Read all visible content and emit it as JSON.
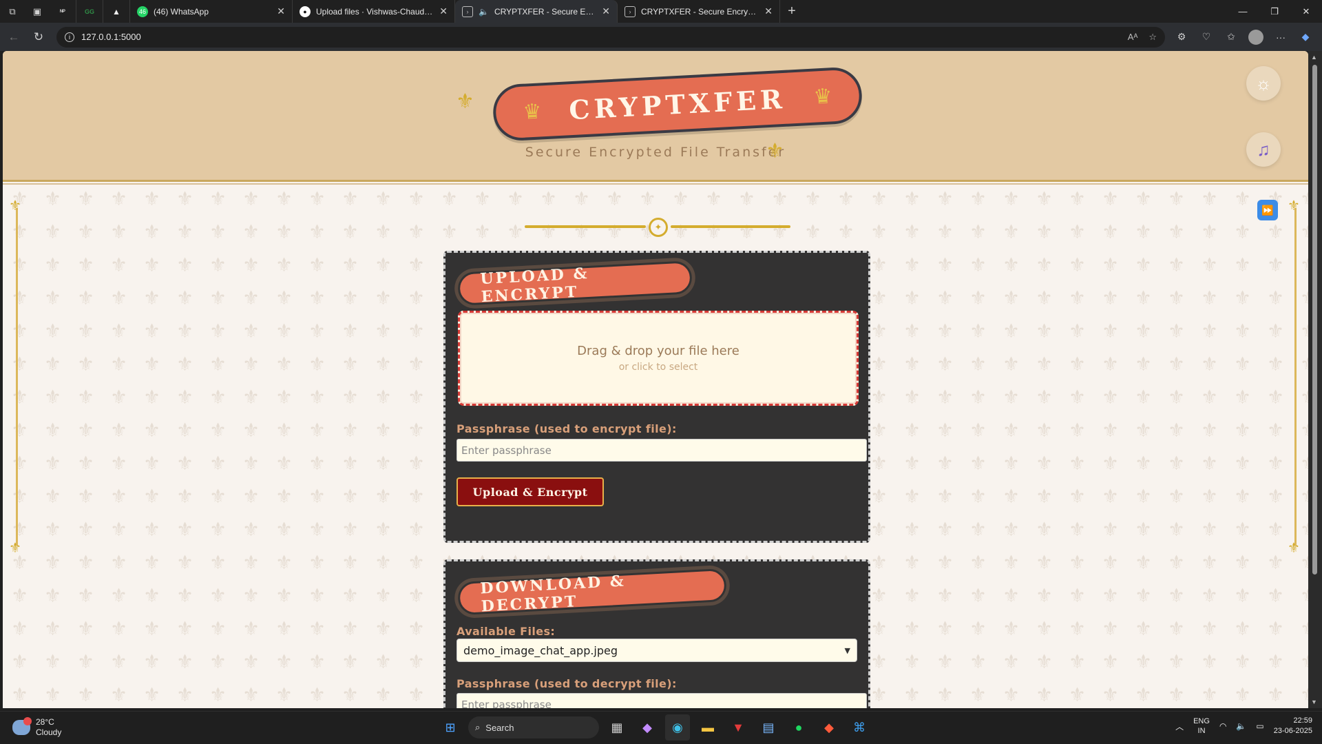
{
  "browser": {
    "tabs": [
      {
        "title": "(46) WhatsApp",
        "favicon": "whatsapp-icon",
        "active": false
      },
      {
        "title": "Upload files · Vishwas-Chaudhary",
        "favicon": "github-icon",
        "active": false
      },
      {
        "title": "CRYPTXFER - Secure Encrypte",
        "favicon": "page-icon",
        "active": true,
        "audio": true
      },
      {
        "title": "CRYPTXFER - Secure Encrypted Fi",
        "favicon": "page-icon",
        "active": false
      }
    ],
    "pinned": [
      "nptel-icon",
      "gfg-icon",
      "drive-icon"
    ],
    "whatsapp_badge": "46",
    "url": "127.0.0.1:5000"
  },
  "page": {
    "logo": "CRYPTXFER",
    "subtitle": "Secure Encrypted File Transfer",
    "upload_card": {
      "title": "UPLOAD & ENCRYPT",
      "dropzone_main": "Drag & drop your file here",
      "dropzone_sub": "or click to select",
      "passphrase_label": "Passphrase (used to encrypt file):",
      "passphrase_placeholder": "Enter passphrase",
      "submit_label": "Upload & Encrypt"
    },
    "download_card": {
      "title": "DOWNLOAD & DECRYPT",
      "files_label": "Available Files:",
      "selected_file": "demo_image_chat_app.jpeg",
      "passphrase_label": "Passphrase (used to decrypt file):",
      "passphrase_placeholder": "Enter passphrase"
    }
  },
  "taskbar": {
    "weather_temp": "28°C",
    "weather_text": "Cloudy",
    "search_label": "Search",
    "lang_top": "ENG",
    "lang_bottom": "IN",
    "time": "22:59",
    "date": "23-06-2025"
  },
  "colors": {
    "header_bg": "#e3c9a3",
    "accent": "#e46d52",
    "gold": "#d4ac2e",
    "card_bg": "#333232",
    "button_bg": "#8a0f0f"
  }
}
